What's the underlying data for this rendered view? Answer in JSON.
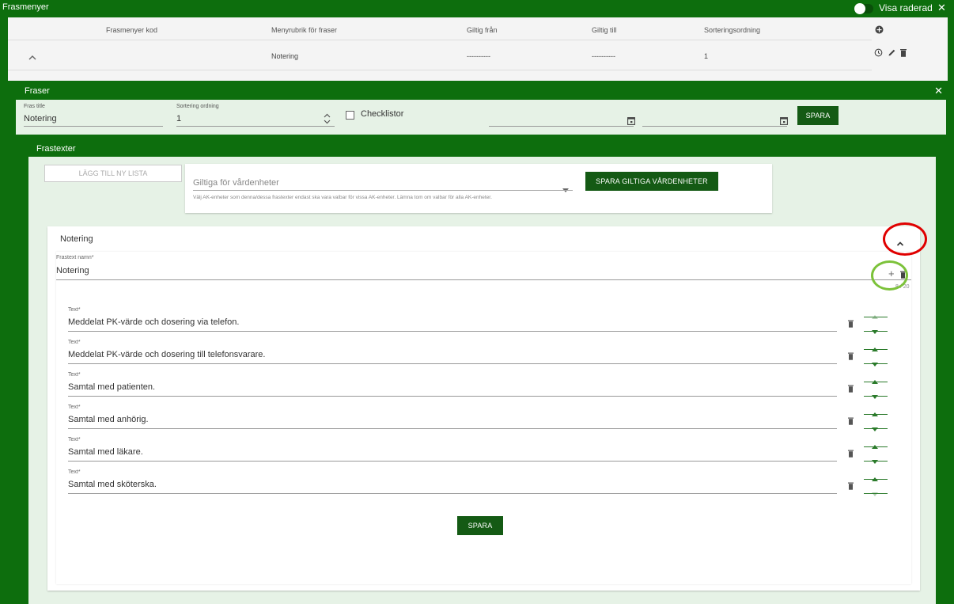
{
  "topbar": {
    "title": "Frasmenyer",
    "toggle_label": "Visa raderad",
    "close": "✕"
  },
  "menu_table": {
    "headers": [
      "Frasmenyer kod",
      "Menyrubrik för fraser",
      "Giltig från",
      "Giltig till",
      "Sorteringsordning"
    ],
    "row": {
      "kod": "",
      "rubrik": "Notering",
      "giltig_fran": "----------",
      "giltig_till": "----------",
      "sortering": "1"
    }
  },
  "fraser": {
    "title": "Fraser",
    "close": "✕",
    "fras_title_label": "Fras title",
    "fras_title_value": "Notering",
    "sortering_label": "Sortering ordning",
    "sortering_value": "1",
    "checklistor_label": "Checklistor",
    "spara_label": "SPARA"
  },
  "frastexter": {
    "title": "Frastexter",
    "lagg_till": "LÄGG TILL NY LISTA",
    "giltiga_placeholder": "Giltiga för vårdenheter",
    "giltiga_hint": "Välj AK-enheter som denna/dessa frastexter endast ska vara valbar för vissa AK-enheter. Lämna tom om valbar för alla AK-enheter.",
    "spara_giltiga": "SPARA GILTIGA VÅRDENHETER",
    "section_title": "Notering",
    "frastext_namn_label": "Frastext namn*",
    "frastext_namn_value": "Notering",
    "counter": "8 / 20",
    "text_label": "Text*",
    "texts": [
      "Meddelat PK-värde och dosering via telefon.",
      "Meddelat PK-värde och dosering till telefonsvarare.",
      "Samtal med patienten.",
      "Samtal med anhörig.",
      "Samtal med läkare.",
      "Samtal med sköterska."
    ],
    "spara_label": "SPARA"
  },
  "colors": {
    "brand_green": "#0d6e0d",
    "panel_bg": "#e6f2e6",
    "annotation_red": "#e00000",
    "annotation_green": "#7cc23a"
  }
}
